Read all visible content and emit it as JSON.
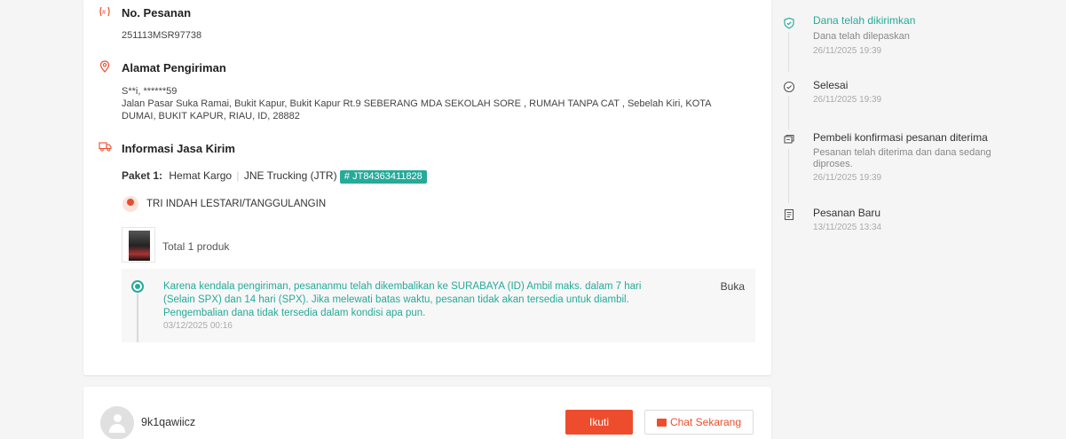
{
  "order_no": {
    "title": "No. Pesanan",
    "value": "251113MSR97738"
  },
  "address": {
    "title": "Alamat Pengiriman",
    "name": "S**i, ******59",
    "line1": "Jalan Pasar Suka Ramai, Bukit Kapur, Bukit Kapur Rt.9 SEBERANG MDA SEKOLAH SORE , RUMAH TANPA CAT , Sebelah Kiri, KOTA",
    "line2": "DUMAI, BUKIT KAPUR, RIAU, ID, 28882"
  },
  "shipping": {
    "title": "Informasi Jasa Kirim",
    "package_label": "Paket 1:",
    "service": "Hemat Kargo",
    "separator": "|",
    "courier": "JNE Trucking (JTR)",
    "tracking": "# JT84363411828",
    "agent": "TRI INDAH LESTARI/TANGGULANGIN",
    "products": "Total 1 produk"
  },
  "notice": {
    "message": "Karena kendala pengiriman, pesananmu telah dikembalikan ke SURABAYA (ID) Ambil maks. dalam 7 hari (Selain SPX) dan 14 hari (SPX). Jika melewati batas waktu, pesanan tidak akan tersedia untuk diambil. Pengembalian dana tidak tersedia dalam kondisi apa pun.",
    "time": "03/12/2025 00:16",
    "open_label": "Buka"
  },
  "timeline": [
    {
      "title": "Dana telah dikirimkan",
      "sub": "Dana telah dilepaskan",
      "time": "26/11/2025 19:39",
      "icon": "shield-icon"
    },
    {
      "title": "Selesai",
      "sub": "",
      "time": "26/11/2025 19:39",
      "icon": "check-circle-icon"
    },
    {
      "title": "Pembeli konfirmasi pesanan diterima",
      "sub": "Pesanan telah diterima dan dana sedang diproses.",
      "time": "26/11/2025 19:39",
      "icon": "box-confirm-icon"
    },
    {
      "title": "Pesanan Baru",
      "sub": "",
      "time": "13/11/2025 13:34",
      "icon": "document-icon"
    }
  ],
  "seller": {
    "name": "9k1qawiicz",
    "follow_label": "Ikuti",
    "chat_label": "Chat Sekarang"
  },
  "colors": {
    "accent": "#ee4d2d",
    "teal": "#26aa99"
  }
}
